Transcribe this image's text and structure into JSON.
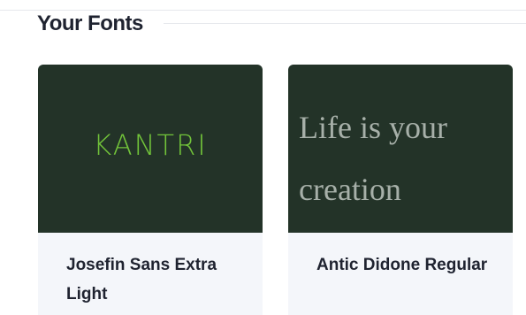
{
  "section": {
    "title": "Your Fonts"
  },
  "cards": [
    {
      "preview_text": "KANTRI",
      "font_name": "Josefin Sans Extra Light"
    },
    {
      "preview_text": "Life is your creation",
      "font_name": "Antic Didone Regular"
    }
  ],
  "colors": {
    "preview_background": "#233328",
    "kantri_text": "#72c43a",
    "serif_preview_text": "#a7b0a9",
    "card_footer_background": "#f4f6fa",
    "title_text": "#1f2330"
  }
}
